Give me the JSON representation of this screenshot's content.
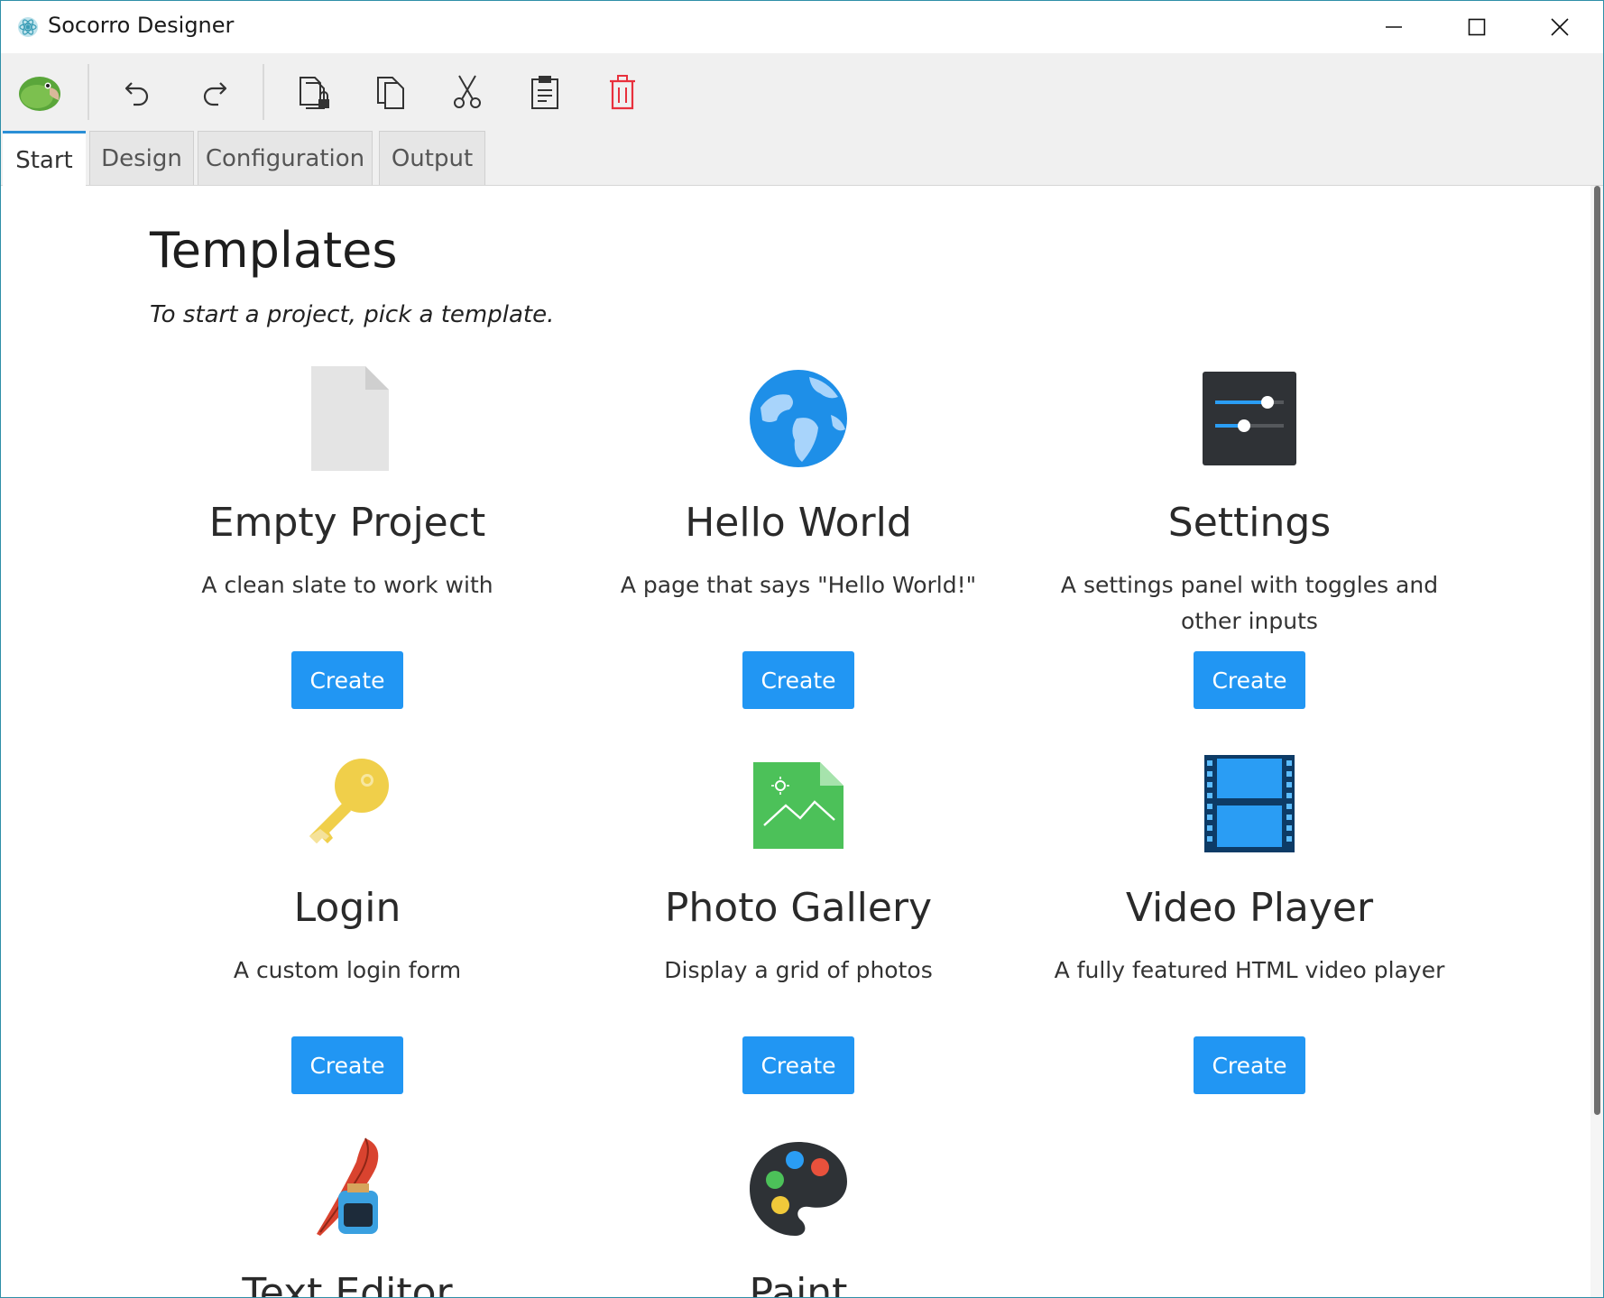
{
  "window": {
    "title": "Socorro Designer"
  },
  "toolbar": {
    "items": [
      {
        "name": "parrot-logo-icon"
      },
      {
        "name": "undo-icon"
      },
      {
        "name": "redo-icon"
      },
      {
        "name": "copy-lock-icon"
      },
      {
        "name": "copy-icon"
      },
      {
        "name": "cut-icon"
      },
      {
        "name": "paste-icon"
      },
      {
        "name": "delete-icon",
        "color": "#e8303c"
      }
    ]
  },
  "tabs": [
    {
      "label": "Start",
      "active": true
    },
    {
      "label": "Design",
      "active": false
    },
    {
      "label": "Configuration",
      "active": false
    },
    {
      "label": "Output",
      "active": false
    }
  ],
  "main": {
    "title": "Templates",
    "subtitle": "To start a project, pick a template.",
    "templates": [
      {
        "name": "Empty Project",
        "description": "A clean slate to work with",
        "button": "Create",
        "icon": "blank-file-icon"
      },
      {
        "name": "Hello World",
        "description": "A page that says \"Hello World!\"",
        "button": "Create",
        "icon": "globe-icon"
      },
      {
        "name": "Settings",
        "description": "A settings panel with toggles and other inputs",
        "button": "Create",
        "icon": "sliders-icon"
      },
      {
        "name": "Login",
        "description": "A custom login form",
        "button": "Create",
        "icon": "key-icon"
      },
      {
        "name": "Photo Gallery",
        "description": "Display a grid of photos",
        "button": "Create",
        "icon": "image-file-icon"
      },
      {
        "name": "Video Player",
        "description": "A fully featured HTML video player",
        "button": "Create",
        "icon": "film-strip-icon"
      },
      {
        "name": "Text Editor",
        "description": "",
        "button": "",
        "icon": "quill-ink-icon"
      },
      {
        "name": "Paint",
        "description": "",
        "button": "",
        "icon": "palette-icon"
      }
    ]
  },
  "colors": {
    "accent": "#2196f3",
    "tab_active_border": "#2b8fd6",
    "delete": "#e8303c"
  }
}
